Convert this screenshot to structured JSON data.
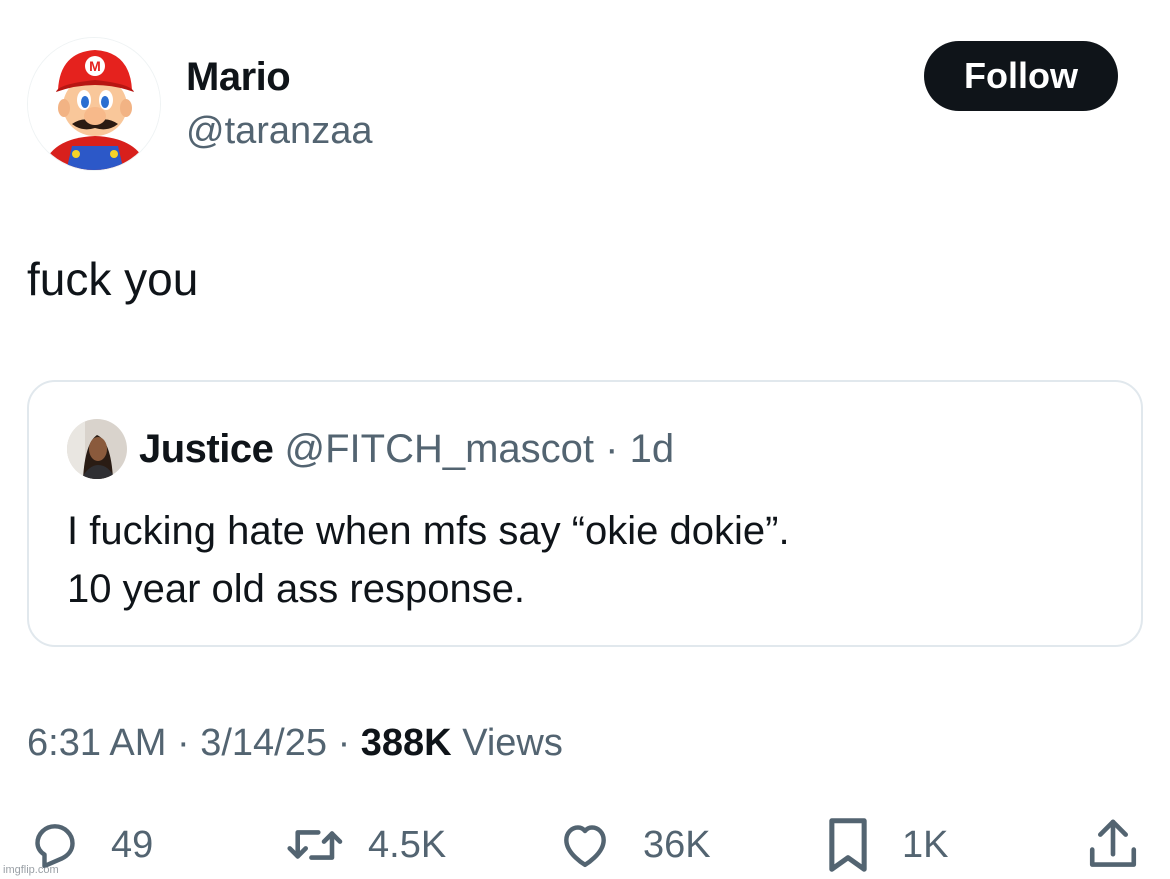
{
  "author": {
    "name": "Mario",
    "handle": "@taranzaa",
    "follow_label": "Follow",
    "avatar_icon": "mario-avatar"
  },
  "tweet": {
    "text": "fuck you"
  },
  "quote": {
    "name": "Justice",
    "handle": "@FITCH_mascot",
    "separator": "·",
    "time": "1d",
    "lines": [
      "I fucking hate when mfs say “okie dokie”.",
      "10 year old ass response."
    ],
    "avatar_icon": "user-avatar"
  },
  "meta": {
    "time": "6:31 AM",
    "separator": "·",
    "date": "3/14/25",
    "views_count": "388K",
    "views_label": "Views"
  },
  "actions": {
    "replies": "49",
    "reposts": "4.5K",
    "likes": "36K",
    "bookmarks": "1K"
  },
  "watermark": "imgflip.com",
  "colors": {
    "text": "#0f1419",
    "secondary": "#536471",
    "border": "#e1e8ed",
    "follow_bg": "#0f1419"
  }
}
